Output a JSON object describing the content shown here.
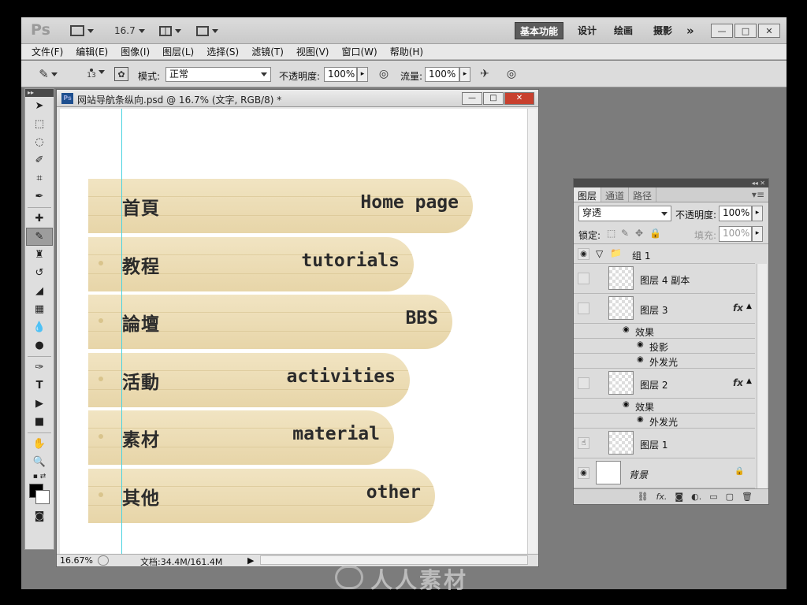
{
  "app": {
    "logo": "Ps",
    "zoom_dropdown": "16.7",
    "workspaces": [
      "基本功能",
      "设计",
      "绘画",
      "摄影"
    ],
    "active_workspace": "基本功能",
    "more": "»"
  },
  "menu": [
    "文件(F)",
    "编辑(E)",
    "图像(I)",
    "图层(L)",
    "选择(S)",
    "滤镜(T)",
    "视图(V)",
    "窗口(W)",
    "帮助(H)"
  ],
  "options": {
    "brush_size": "13",
    "mode_label": "模式:",
    "mode_value": "正常",
    "opacity_label": "不透明度:",
    "opacity_value": "100%",
    "flow_label": "流量:",
    "flow_value": "100%"
  },
  "document": {
    "title": "网站导航条纵向.psd @ 16.7% (文字, RGB/8) *",
    "zoom_status": "16.67%",
    "doc_size": "文档:34.4M/161.4M",
    "nav_items": [
      {
        "cn": "首頁",
        "en": "Home page"
      },
      {
        "cn": "教程",
        "en": "tutorials"
      },
      {
        "cn": "論壇",
        "en": "BBS"
      },
      {
        "cn": "活動",
        "en": "activities"
      },
      {
        "cn": "素材",
        "en": "material"
      },
      {
        "cn": "其他",
        "en": "other"
      }
    ]
  },
  "layers_panel": {
    "tabs": [
      "图层",
      "通道",
      "路径"
    ],
    "blend_mode": "穿透",
    "opacity_label": "不透明度:",
    "opacity_value": "100%",
    "lock_label": "锁定:",
    "fill_label": "填充:",
    "fill_value": "100%",
    "group_name": "组 1",
    "layer_4_copy": "图层 4 副本",
    "layer_3": "图层 3",
    "effects_label": "效果",
    "drop_shadow": "投影",
    "outer_glow": "外发光",
    "layer_2": "图层 2",
    "layer_1": "图层 1",
    "background": "背景",
    "fx": "fx"
  },
  "watermark": "人人素材"
}
